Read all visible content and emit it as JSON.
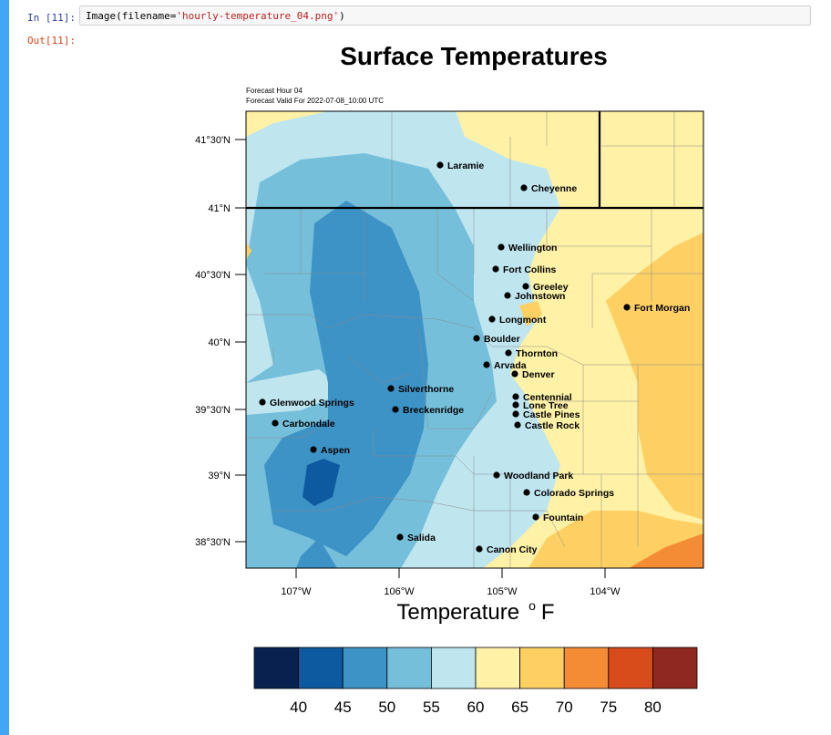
{
  "notebook": {
    "input_prompt": "In [11]:",
    "output_prompt": "Out[11]:",
    "code_prefix": "Image(filename=",
    "code_string": "'hourly-temperature_04.png'",
    "code_suffix": ")"
  },
  "figure": {
    "title": "Surface Temperatures",
    "subtitle_line1": "Forecast Hour 04",
    "subtitle_line2": "Forecast Valid For 2022-07-08_10:00 UTC",
    "colorbar_label": "Temperature",
    "colorbar_unit_superscript": "o",
    "colorbar_unit": "F",
    "lat_ticks": [
      "41°30'N",
      "41°N",
      "40°30'N",
      "40°N",
      "39°30'N",
      "39°N",
      "38°30'N"
    ],
    "lon_ticks": [
      "107°W",
      "106°W",
      "105°W",
      "104°W"
    ],
    "colorbar_ticks": [
      "40",
      "45",
      "50",
      "55",
      "60",
      "65",
      "70",
      "75",
      "80"
    ],
    "colorbar_colors": [
      "#08214f",
      "#0d5aa0",
      "#3d93c6",
      "#75bfdb",
      "#bfe5ef",
      "#fff1a5",
      "#fed064",
      "#f48b35",
      "#d84c1b",
      "#8e2820"
    ],
    "cities": [
      {
        "name": "Laramie"
      },
      {
        "name": "Cheyenne"
      },
      {
        "name": "Wellington"
      },
      {
        "name": "Fort Collins"
      },
      {
        "name": "Greeley"
      },
      {
        "name": "Johnstown"
      },
      {
        "name": "Fort Morgan"
      },
      {
        "name": "Longmont"
      },
      {
        "name": "Boulder"
      },
      {
        "name": "Thornton"
      },
      {
        "name": "Arvada"
      },
      {
        "name": "Denver"
      },
      {
        "name": "Silverthorne"
      },
      {
        "name": "Glenwood Springs"
      },
      {
        "name": "Breckenridge"
      },
      {
        "name": "Centennial"
      },
      {
        "name": "Lone Tree"
      },
      {
        "name": "Castle Pines"
      },
      {
        "name": "Carbondale"
      },
      {
        "name": "Castle Rock"
      },
      {
        "name": "Aspen"
      },
      {
        "name": "Woodland Park"
      },
      {
        "name": "Colorado Springs"
      },
      {
        "name": "Fountain"
      },
      {
        "name": "Salida"
      },
      {
        "name": "Canon City"
      }
    ]
  }
}
